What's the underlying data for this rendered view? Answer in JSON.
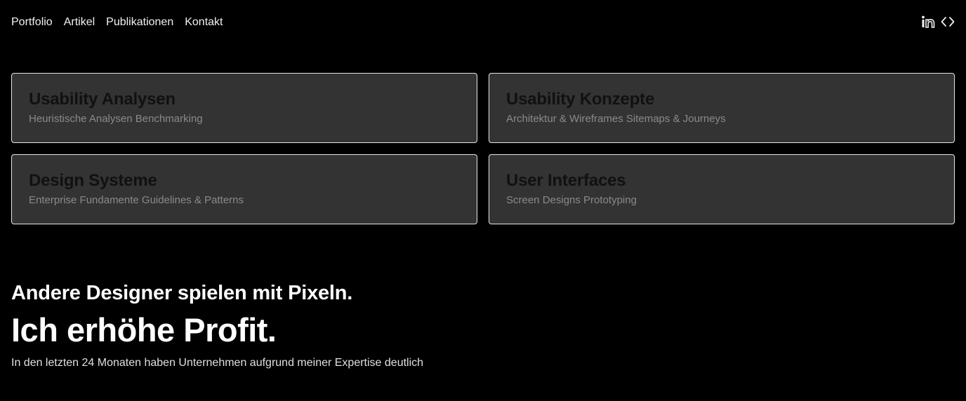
{
  "nav": {
    "items": [
      {
        "label": "Portfolio"
      },
      {
        "label": "Artikel"
      },
      {
        "label": "Publikationen"
      },
      {
        "label": "Kontakt"
      }
    ]
  },
  "social": {
    "icons": [
      "linkedin-icon",
      "code-icon"
    ]
  },
  "cards": [
    {
      "title": "Usability Analysen",
      "subtitle": "Heuristische Analysen Benchmarking"
    },
    {
      "title": "Usability Konzepte",
      "subtitle": "Architektur & Wireframes Sitemaps & Journeys"
    },
    {
      "title": "Design Systeme",
      "subtitle": "Enterprise Fundamente Guidelines & Patterns"
    },
    {
      "title": "User Interfaces",
      "subtitle": "Screen Designs Prototyping"
    }
  ],
  "hero": {
    "subheading": "Andere Designer spielen mit Pixeln.",
    "heading": "Ich erhöhe Profit.",
    "text": "In den letzten 24 Monaten haben Unternehmen aufgrund meiner Expertise deutlich"
  },
  "colors": {
    "background": "#000000",
    "card_background": "#333333",
    "card_border": "#e6e6e6",
    "card_title": "#111111",
    "card_subtitle": "#8a8a8a",
    "text": "#ffffff"
  }
}
